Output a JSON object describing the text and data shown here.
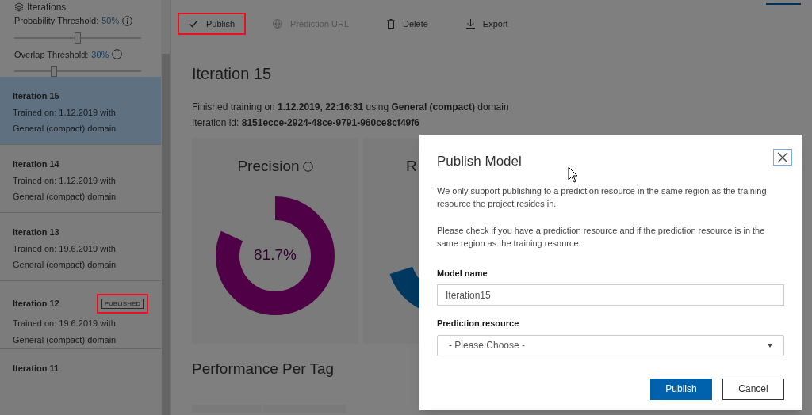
{
  "sidebar": {
    "title": "Iterations",
    "thresholds": [
      {
        "label": "Probability Threshold:",
        "value": "50%",
        "level": 0.5
      },
      {
        "label": "Overlap Threshold:",
        "value": "30%",
        "level": 0.31
      }
    ],
    "items": [
      {
        "title": "Iteration 15",
        "line_1": "Trained on: 1.12.2019 with",
        "line_2": "General (compact) domain",
        "selected": true
      },
      {
        "title": "Iteration 14",
        "line_1": "Trained on: 1.12.2019 with",
        "line_2": "General (compact) domain",
        "selected": false
      },
      {
        "title": "Iteration 13",
        "line_1": "Trained on: 19.6.2019 with",
        "line_2": "General (compact) domain",
        "selected": false
      },
      {
        "title": "Iteration 12",
        "badge": "PUBLISHED",
        "badge_highlighted": true,
        "line_1": "Trained on: 19.6.2019 with",
        "line_2": "General (compact) domain",
        "selected": false
      },
      {
        "title": "Iteration 11",
        "selected": false
      }
    ]
  },
  "toolbar": [
    {
      "kind": "check",
      "label": "Publish",
      "disabled": false,
      "highlighted": true
    },
    {
      "kind": "globe",
      "label": "Prediction URL",
      "disabled": true,
      "highlighted": false
    },
    {
      "kind": "trash",
      "label": "Delete",
      "disabled": false,
      "highlighted": false
    },
    {
      "kind": "download",
      "label": "Export",
      "disabled": false,
      "highlighted": false
    }
  ],
  "main": {
    "title": "Iteration 15",
    "info_1": "Finished training on **1.12.2019, 22:16:31** using **General (compact)** domain",
    "info_2": "Iteration id: **8151ecce-2924-48ce-9791-960ce8cf49f6**",
    "metrics": [
      {
        "title": "Precision",
        "value": "81.7%",
        "level": 0.817,
        "color": "#4f0046"
      },
      {
        "title": "R",
        "color": "#00385f"
      }
    ],
    "section_title": "Performance Per Tag"
  },
  "dialog": {
    "title": "Publish Model",
    "paragraphs": [
      "We only support publishing to a prediction resource in the same region as the training resource the project resides in.",
      "Please check if you have a prediction resource and if the prediction resource is in the same region as the training resource."
    ],
    "model_name": {
      "label": "Model name",
      "value": "Iteration15"
    },
    "resource": {
      "label": "Prediction resource",
      "value": "- Please Choose -"
    },
    "buttons": [
      {
        "label": "Publish",
        "primary": true
      },
      {
        "label": "Cancel",
        "primary": false
      }
    ]
  }
}
